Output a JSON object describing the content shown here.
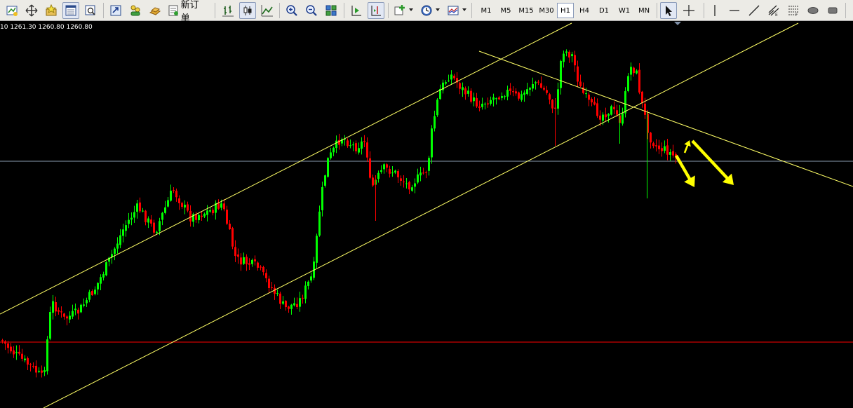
{
  "toolbar": {
    "new_order_label": "新订单",
    "timeframes": [
      "M1",
      "M5",
      "M15",
      "M30",
      "H1",
      "H4",
      "D1",
      "W1",
      "MN"
    ],
    "active_timeframe": "H1"
  },
  "chart": {
    "ohlc_readout": "10 1261.30 1260.80 1260.80",
    "background": "#000000",
    "bull_color": "#00ff00",
    "bear_color": "#ff0000",
    "trendline_color": "#ffff66",
    "arrow_color": "#ffff00",
    "support_line_color": "#ff0000",
    "bid_line_color": "#8a9bb0"
  }
}
